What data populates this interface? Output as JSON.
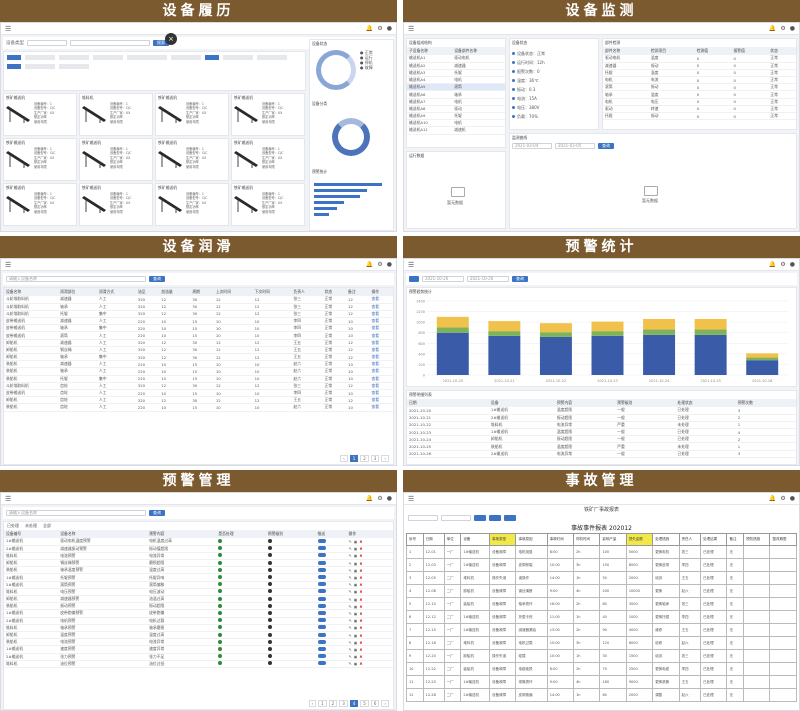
{
  "panels": {
    "history": {
      "title": "设备履历"
    },
    "monitor": {
      "title": "设备监测"
    },
    "lube": {
      "title": "设备润滑"
    },
    "stats": {
      "title": "预警统计"
    },
    "alarm": {
      "title": "预警管理"
    },
    "accident": {
      "title": "事故管理"
    }
  },
  "history": {
    "filter_label": "设备类型",
    "search_label": "搜索",
    "cards": [
      "铁矿输送机",
      "堆料机",
      "铁矿输送机",
      "铁矿输送机",
      "铁矿输送机",
      "铁矿输送机",
      "铁矿输送机",
      "铁矿输送机",
      "铁矿输送机",
      "铁矿输送机",
      "铁矿输送机",
      "铁矿输送机"
    ],
    "card_info": [
      "设备编号：1",
      "设备型号：CJC",
      "生产厂家：XX",
      "额定功率",
      "使用年限"
    ],
    "side_titles": [
      "设备状态",
      "设备分类",
      "预警统计"
    ],
    "ring_values": [
      "20",
      "200",
      "360"
    ]
  },
  "monitor": {
    "tree_title": "设备组成结构",
    "tree_cols": [
      "子设备名称",
      "设备部件名称"
    ],
    "tree_rows": [
      [
        "输送机A1",
        "驱动电机"
      ],
      [
        "输送机A2",
        "减速器"
      ],
      [
        "输送机A3",
        "托辊"
      ],
      [
        "输送机A4",
        "电机"
      ],
      [
        "输送机A5",
        "滚筒"
      ],
      [
        "输送机A6",
        "轴承"
      ],
      [
        "输送机A7",
        "电机"
      ],
      [
        "输送机A8",
        "驱动"
      ],
      [
        "输送机A9",
        "托辊"
      ],
      [
        "输送机A10",
        "电机"
      ],
      [
        "输送机A11",
        "减速机"
      ]
    ],
    "status_title": "设备状态",
    "status_items": [
      "设备状态：正常",
      "运行时间：12h",
      "报警次数：0",
      "温度：36℃",
      "振动：0.3",
      "电流：15A",
      "电压：380V",
      "负载：70%"
    ],
    "right_title": "部件检测",
    "right_cols": [
      "部件名称",
      "检测项目",
      "检测值",
      "报警值",
      "状态"
    ],
    "right_rows": [
      [
        "驱动电机",
        "温度",
        "0",
        "0",
        "正常"
      ],
      [
        "减速器",
        "振动",
        "0",
        "0",
        "正常"
      ],
      [
        "托辊",
        "温度",
        "0",
        "0",
        "正常"
      ],
      [
        "电机",
        "电流",
        "0",
        "0",
        "正常"
      ],
      [
        "滚筒",
        "振动",
        "0",
        "0",
        "正常"
      ],
      [
        "轴承",
        "温度",
        "0",
        "0",
        "正常"
      ],
      [
        "电机",
        "电压",
        "0",
        "0",
        "正常"
      ],
      [
        "驱动",
        "转速",
        "0",
        "0",
        "正常"
      ],
      [
        "托辊",
        "振动",
        "0",
        "0",
        "正常"
      ]
    ],
    "chart_title": "监测曲线",
    "empty_text": "暂无数据",
    "date_from": "2021-03-04",
    "date_to": "2021-03-05",
    "query_btn": "查询",
    "bottom_title": "运行数据"
  },
  "lube": {
    "search_placeholder": "请输入设备名称",
    "search_btn": "查询",
    "cols": [
      "设备名称",
      "润滑部位",
      "润滑方式",
      "油品",
      "加油量",
      "周期",
      "上次时间",
      "下次时间",
      "负责人",
      "状态",
      "备注",
      "操作"
    ],
    "rows": [
      [
        "斗轮堆取料机",
        "减速器",
        "人工",
        "320",
        "12",
        "30",
        "12",
        "12",
        "张三",
        "正常",
        "12",
        "查看"
      ],
      [
        "斗轮堆取料机",
        "轴承",
        "人工",
        "320",
        "12",
        "30",
        "12",
        "12",
        "张三",
        "正常",
        "12",
        "查看"
      ],
      [
        "斗轮堆取料机",
        "托辊",
        "集中",
        "320",
        "12",
        "30",
        "12",
        "12",
        "张三",
        "正常",
        "12",
        "查看"
      ],
      [
        "皮带输送机",
        "减速器",
        "人工",
        "220",
        "10",
        "15",
        "10",
        "10",
        "李四",
        "正常",
        "10",
        "查看"
      ],
      [
        "皮带输送机",
        "轴承",
        "集中",
        "220",
        "10",
        "15",
        "10",
        "10",
        "李四",
        "正常",
        "10",
        "查看"
      ],
      [
        "皮带输送机",
        "滚筒",
        "人工",
        "220",
        "10",
        "15",
        "10",
        "10",
        "李四",
        "正常",
        "10",
        "查看"
      ],
      [
        "卸船机",
        "减速器",
        "人工",
        "320",
        "12",
        "30",
        "12",
        "12",
        "王五",
        "正常",
        "12",
        "查看"
      ],
      [
        "卸船机",
        "钢丝绳",
        "人工",
        "320",
        "12",
        "30",
        "12",
        "12",
        "王五",
        "正常",
        "12",
        "查看"
      ],
      [
        "卸船机",
        "轴承",
        "集中",
        "320",
        "12",
        "30",
        "12",
        "12",
        "王五",
        "正常",
        "12",
        "查看"
      ],
      [
        "装船机",
        "减速器",
        "人工",
        "220",
        "10",
        "15",
        "10",
        "10",
        "赵六",
        "正常",
        "10",
        "查看"
      ],
      [
        "装船机",
        "轴承",
        "人工",
        "220",
        "10",
        "15",
        "10",
        "10",
        "赵六",
        "正常",
        "10",
        "查看"
      ],
      [
        "装船机",
        "托辊",
        "集中",
        "220",
        "10",
        "15",
        "10",
        "10",
        "赵六",
        "正常",
        "10",
        "查看"
      ],
      [
        "斗轮堆取料机",
        "齿轮",
        "人工",
        "320",
        "12",
        "30",
        "12",
        "12",
        "张三",
        "正常",
        "12",
        "查看"
      ],
      [
        "皮带输送机",
        "齿轮",
        "人工",
        "220",
        "10",
        "15",
        "10",
        "10",
        "李四",
        "正常",
        "10",
        "查看"
      ],
      [
        "卸船机",
        "齿轮",
        "人工",
        "320",
        "12",
        "30",
        "12",
        "12",
        "王五",
        "正常",
        "12",
        "查看"
      ],
      [
        "装船机",
        "齿轮",
        "人工",
        "220",
        "10",
        "15",
        "10",
        "10",
        "赵六",
        "正常",
        "10",
        "查看"
      ]
    ],
    "pages": [
      "1",
      "2",
      "3"
    ]
  },
  "stats": {
    "date_from": "2021-10-20",
    "date_to": "2021-10-26",
    "query_btn": "查询",
    "chart_title": "预警趋势统计",
    "table_title": "预警明细列表",
    "cols": [
      "日期",
      "设备",
      "预警内容",
      "预警级别",
      "处理状态",
      "预警次数"
    ],
    "rows": [
      [
        "2021-10-20",
        "1#输送机",
        "温度超限",
        "一般",
        "已处理",
        "3"
      ],
      [
        "2021-10-21",
        "2#输送机",
        "振动超限",
        "一般",
        "已处理",
        "2"
      ],
      [
        "2021-10-22",
        "堆料机",
        "电流异常",
        "严重",
        "未处理",
        "1"
      ],
      [
        "2021-10-23",
        "1#输送机",
        "温度超限",
        "一般",
        "已处理",
        "4"
      ],
      [
        "2021-10-24",
        "卸船机",
        "振动超限",
        "一般",
        "已处理",
        "2"
      ],
      [
        "2021-10-25",
        "装船机",
        "温度超限",
        "严重",
        "未处理",
        "1"
      ],
      [
        "2021-10-26",
        "2#输送机",
        "电流异常",
        "一般",
        "已处理",
        "3"
      ]
    ],
    "colors": {
      "low": "#3a5ca8",
      "mid": "#7fb35a",
      "high": "#f0c14b"
    }
  },
  "chart_data": {
    "type": "bar",
    "categories": [
      "2021-10-20",
      "2021-10-21",
      "2021-10-22",
      "2021-10-23",
      "2021-10-24",
      "2021-10-25",
      "2021-10-26"
    ],
    "series": [
      {
        "values": [
          800,
          740,
          720,
          740,
          760,
          760,
          280
        ]
      },
      {
        "values": [
          100,
          90,
          90,
          90,
          100,
          100,
          50
        ]
      },
      {
        "values": [
          200,
          190,
          170,
          180,
          200,
          200,
          80
        ]
      }
    ],
    "ylim": [
      0,
      1400
    ],
    "yticks": [
      "0",
      "200",
      "400",
      "600",
      "800",
      "1000",
      "1200",
      "1400"
    ],
    "stacked": true,
    "grid": true
  },
  "alarm": {
    "search_placeholder": "请输入设备名称",
    "search_btn": "查询",
    "tabs": [
      "已处理",
      "未处理",
      "全部"
    ],
    "cols": [
      "设备编号",
      "设备名称",
      "预警内容",
      "是否处理",
      "预警级别",
      "推送",
      "操作"
    ],
    "rows": [
      [
        "1#输送机",
        "驱动电机温度预警",
        "电机温度过高"
      ],
      [
        "2#输送机",
        "减速器振动预警",
        "振动值超限"
      ],
      [
        "堆料机",
        "电流预警",
        "电流异常"
      ],
      [
        "卸船机",
        "钢丝绳预警",
        "磨损超限"
      ],
      [
        "装船机",
        "轴承温度预警",
        "温度过高"
      ],
      [
        "1#输送机",
        "托辊预警",
        "托辊异响"
      ],
      [
        "2#输送机",
        "滚筒预警",
        "滚筒偏移"
      ],
      [
        "堆料机",
        "电压预警",
        "电压波动"
      ],
      [
        "卸船机",
        "减速器预警",
        "油温过高"
      ],
      [
        "装船机",
        "振动预警",
        "振动超限"
      ],
      [
        "1#输送机",
        "皮带跑偏预警",
        "皮带跑偏"
      ],
      [
        "2#输送机",
        "电机预警",
        "电机过载"
      ],
      [
        "堆料机",
        "轴承预警",
        "轴承磨损"
      ],
      [
        "卸船机",
        "温度预警",
        "温度过高"
      ],
      [
        "装船机",
        "电流预警",
        "电流异常"
      ],
      [
        "1#输送机",
        "速度预警",
        "速度异常"
      ],
      [
        "2#输送机",
        "张力预警",
        "张力不足"
      ],
      [
        "堆料机",
        "油位预警",
        "油位过低"
      ]
    ],
    "pages": [
      "1",
      "2",
      "3",
      "4",
      "5",
      "6"
    ]
  },
  "accident": {
    "doc_title": "铁矿厂事故报表",
    "sheet_title": "事故事件报表 202012",
    "cols": [
      "序号",
      "日期",
      "单位",
      "设备",
      "事故类型",
      "事故原因",
      "事故时间",
      "停机时间",
      "影响产量",
      "损失金额",
      "处理措施",
      "责任人",
      "处理结果",
      "备注",
      "预防措施",
      "整改期限"
    ],
    "rows": [
      [
        "1",
        "12-01",
        "一厂",
        "1#输送机",
        "设备故障",
        "电机烧毁",
        "8:00",
        "2h",
        "100",
        "5000",
        "更换电机",
        "张三",
        "已处理",
        "无"
      ],
      [
        "2",
        "12-03",
        "一厂",
        "2#输送机",
        "设备故障",
        "皮带断裂",
        "10:00",
        "3h",
        "150",
        "8000",
        "更换皮带",
        "李四",
        "已处理",
        "无"
      ],
      [
        "3",
        "12-05",
        "二厂",
        "堆料机",
        "操作失误",
        "误操作",
        "14:00",
        "1h",
        "50",
        "2000",
        "培训",
        "王五",
        "已处理",
        "无"
      ],
      [
        "4",
        "12-08",
        "二厂",
        "卸船机",
        "设备故障",
        "钢丝绳断",
        "9:00",
        "4h",
        "200",
        "10000",
        "更换",
        "赵六",
        "已处理",
        "无"
      ],
      [
        "5",
        "12-10",
        "一厂",
        "装船机",
        "设备故障",
        "轴承损坏",
        "16:00",
        "2h",
        "80",
        "3000",
        "更换轴承",
        "张三",
        "已处理",
        "无"
      ],
      [
        "6",
        "12-12",
        "二厂",
        "1#输送机",
        "设备故障",
        "托辊卡死",
        "11:00",
        "1h",
        "40",
        "1000",
        "更换托辊",
        "李四",
        "已处理",
        "无"
      ],
      [
        "7",
        "12-15",
        "一厂",
        "2#输送机",
        "设备故障",
        "减速器漏油",
        "13:00",
        "2h",
        "90",
        "4000",
        "维修",
        "王五",
        "已处理",
        "无"
      ],
      [
        "8",
        "12-18",
        "二厂",
        "堆料机",
        "设备故障",
        "电机过载",
        "15:00",
        "3h",
        "120",
        "6000",
        "检修",
        "赵六",
        "已处理",
        "无"
      ],
      [
        "9",
        "12-20",
        "一厂",
        "卸船机",
        "操作失误",
        "碰撞",
        "10:00",
        "1h",
        "30",
        "1500",
        "培训",
        "张三",
        "已处理",
        "无"
      ],
      [
        "10",
        "12-22",
        "二厂",
        "装船机",
        "设备故障",
        "电缆破损",
        "8:00",
        "2h",
        "70",
        "2500",
        "更换电缆",
        "李四",
        "已处理",
        "无"
      ],
      [
        "11",
        "12-25",
        "一厂",
        "1#输送机",
        "设备故障",
        "滚筒损坏",
        "9:00",
        "4h",
        "180",
        "9000",
        "更换滚筒",
        "王五",
        "已处理",
        "无"
      ],
      [
        "12",
        "12-28",
        "二厂",
        "2#输送机",
        "设备故障",
        "皮带跑偏",
        "14:00",
        "1h",
        "60",
        "2000",
        "调整",
        "赵六",
        "已处理",
        "无"
      ]
    ]
  }
}
